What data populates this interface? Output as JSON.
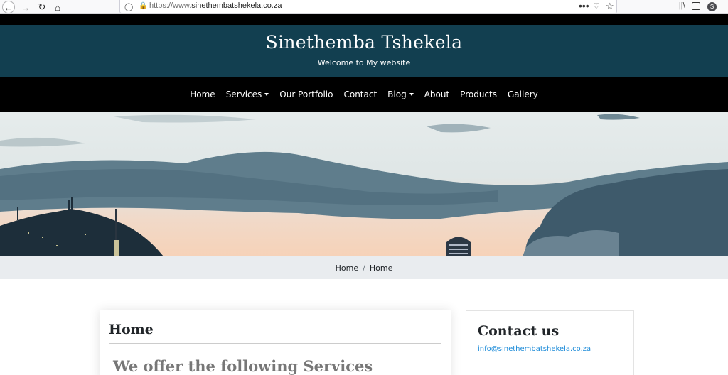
{
  "browser": {
    "url_scheme": "https://www.",
    "url_domain": "sinethembatshekela.co.za",
    "url_dots": "•••",
    "account_initial": "S",
    "icons": [
      "back-icon",
      "forward-icon",
      "reload-icon",
      "home-icon",
      "shield-icon",
      "lock-icon",
      "more-icon",
      "pocket-icon",
      "star-icon",
      "library-icon",
      "sidebar-icon",
      "account-icon"
    ]
  },
  "header": {
    "title": "Sinethemba Tshekela",
    "tagline": "Welcome to My website",
    "background": "#123f50"
  },
  "nav": {
    "items": [
      {
        "label": "Home"
      },
      {
        "label": "Services"
      },
      {
        "label": "Our Portfolio"
      },
      {
        "label": "Contact"
      },
      {
        "label": "Blog"
      },
      {
        "label": "About"
      },
      {
        "label": "Products"
      },
      {
        "label": "Gallery"
      }
    ]
  },
  "breadcrumb": {
    "first": "Home",
    "separator": "/",
    "current": "Home"
  },
  "main": {
    "title": "Home",
    "subtitle": "We offer the following Services"
  },
  "sidebar": {
    "contact_title": "Contact us",
    "email": "info@sinethembatshekela.co.za",
    "link_color": "#1a8ad8"
  }
}
